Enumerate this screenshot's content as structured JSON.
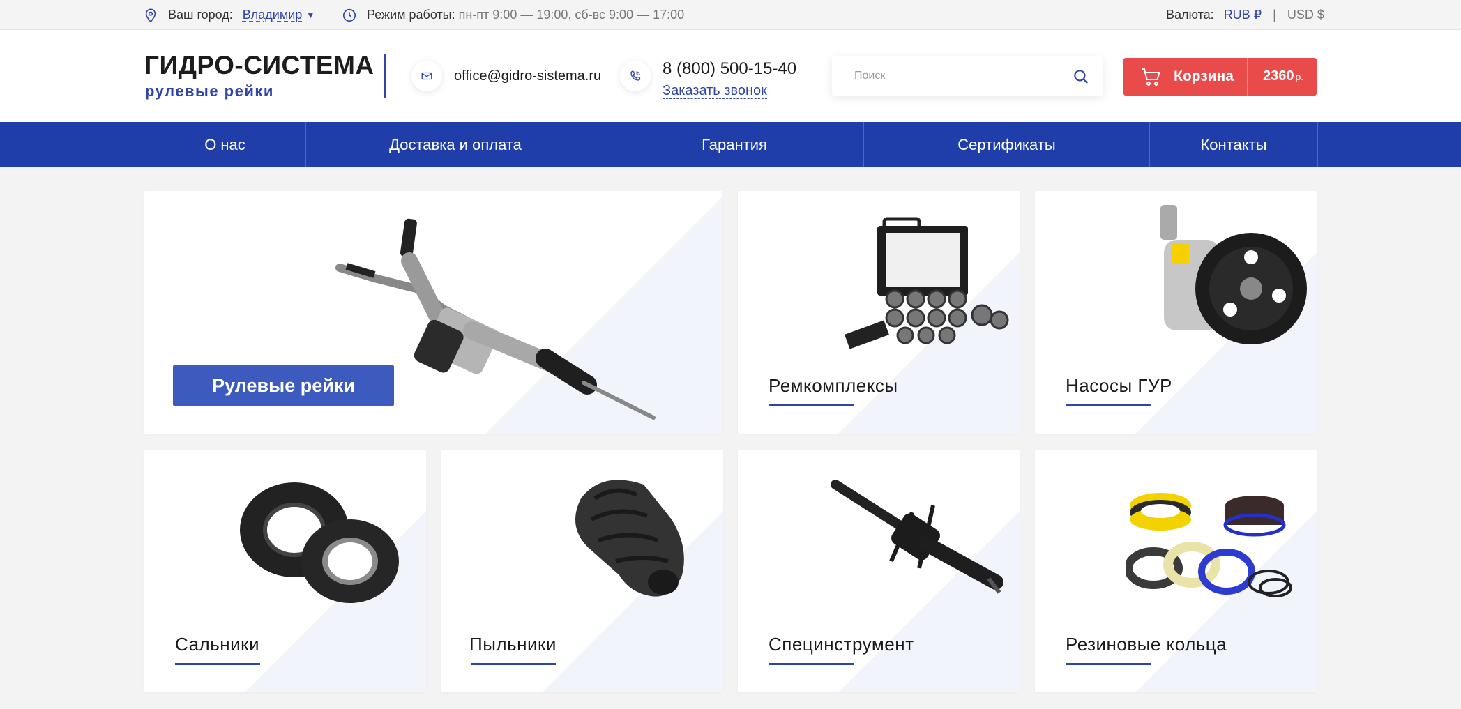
{
  "topbar": {
    "city_label": "Ваш город:",
    "city_value": "Владимир",
    "hours_label": "Режим работы:",
    "hours_value": "пн-пт 9:00 — 19:00, сб-вс 9:00 — 17:00",
    "currency_label": "Валюта:",
    "currency_rub": "RUB ₽",
    "currency_sep": "|",
    "currency_usd": "USD $"
  },
  "header": {
    "logo_title": "ГИДРО-СИСТЕМА",
    "logo_subtitle": "рулевые рейки",
    "email": "office@gidro-sistema.ru",
    "phone": "8 (800) 500-15-40",
    "callback": "Заказать звонок",
    "search_placeholder": "Поиск",
    "cart_label": "Корзина",
    "cart_sum": "2360",
    "cart_currency": "р."
  },
  "nav": {
    "items": [
      {
        "label": "О нас"
      },
      {
        "label": "Доставка и оплата"
      },
      {
        "label": "Гарантия"
      },
      {
        "label": "Сертификаты"
      },
      {
        "label": "Контакты"
      }
    ]
  },
  "categories": [
    {
      "title": "Рулевые рейки",
      "icon": "steering-rack-icon"
    },
    {
      "title": "Ремкомплексы",
      "icon": "repair-kit-icon"
    },
    {
      "title": "Насосы ГУР",
      "icon": "pump-icon"
    },
    {
      "title": "Сальники",
      "icon": "oil-seal-icon"
    },
    {
      "title": "Пыльники",
      "icon": "boot-icon"
    },
    {
      "title": "Специнструмент",
      "icon": "special-tool-icon"
    },
    {
      "title": "Резиновые кольца",
      "icon": "rubber-rings-icon"
    }
  ],
  "colors": {
    "brand_blue": "#1f3ea9",
    "cart_red": "#e94b4b",
    "hero_button": "#3d5bbf"
  }
}
